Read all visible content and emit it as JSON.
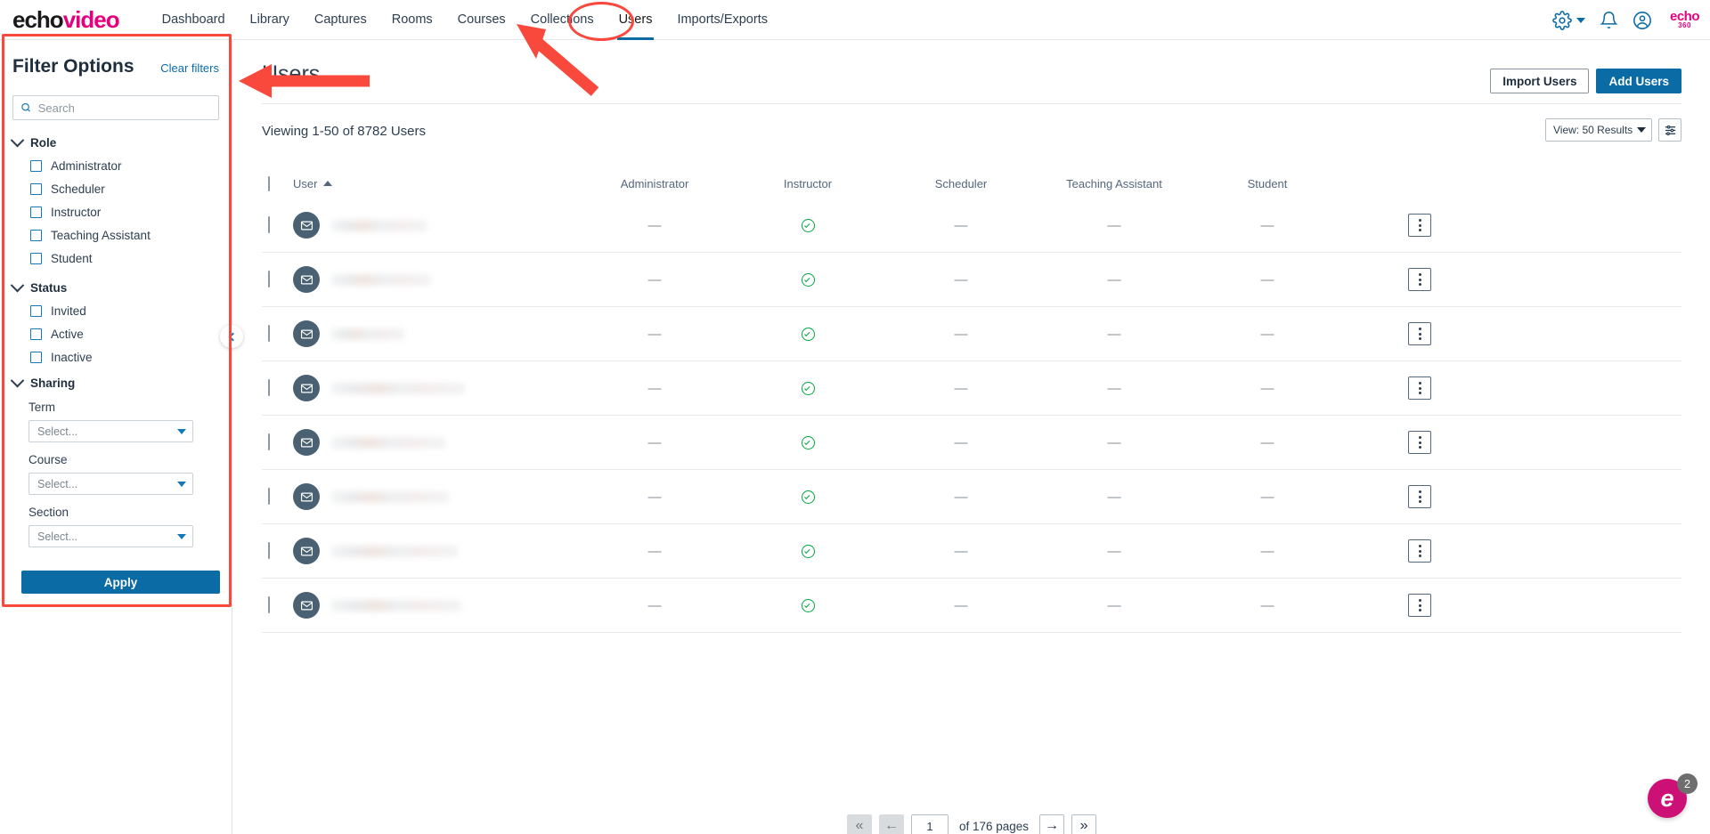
{
  "topnav": {
    "logo_echo": "echo",
    "logo_video": "video",
    "links": [
      {
        "label": "Dashboard",
        "active": false
      },
      {
        "label": "Library",
        "active": false
      },
      {
        "label": "Captures",
        "active": false
      },
      {
        "label": "Rooms",
        "active": false
      },
      {
        "label": "Courses",
        "active": false
      },
      {
        "label": "Collections",
        "active": false
      },
      {
        "label": "Users",
        "active": true
      },
      {
        "label": "Imports/Exports",
        "active": false
      }
    ],
    "icons": {
      "settings": "gear-icon",
      "settings_caret": "chevron-down-icon",
      "notifications": "bell-icon",
      "account": "user-avatar-icon"
    },
    "brand_badge_top": "echo",
    "brand_badge_bottom": "360"
  },
  "sidebar": {
    "title": "Filter Options",
    "clear_label": "Clear filters",
    "search_placeholder": "Search",
    "search_value": "",
    "groups": [
      {
        "label": "Role",
        "options": [
          {
            "label": "Administrator",
            "checked": false
          },
          {
            "label": "Scheduler",
            "checked": false
          },
          {
            "label": "Instructor",
            "checked": false
          },
          {
            "label": "Teaching Assistant",
            "checked": false
          },
          {
            "label": "Student",
            "checked": false
          }
        ]
      },
      {
        "label": "Status",
        "options": [
          {
            "label": "Invited",
            "checked": false
          },
          {
            "label": "Active",
            "checked": false
          },
          {
            "label": "Inactive",
            "checked": false
          }
        ]
      }
    ],
    "sharing": {
      "label": "Sharing",
      "fields": [
        {
          "label": "Term",
          "value": "Select..."
        },
        {
          "label": "Course",
          "value": "Select..."
        },
        {
          "label": "Section",
          "value": "Select..."
        }
      ]
    },
    "apply_label": "Apply"
  },
  "main": {
    "page_title": "Users",
    "import_label": "Import Users",
    "add_label": "Add Users",
    "viewing_text": "Viewing 1-50 of 8782 Users",
    "view_select_label": "View: 50 Results",
    "settings_icon": "sliders-icon"
  },
  "table": {
    "columns": [
      "User",
      "Administrator",
      "Instructor",
      "Scheduler",
      "Teaching Assistant",
      "Student"
    ],
    "sort_column": "User",
    "sort_direction": "asc",
    "rows": [
      {
        "user": "",
        "redacted": true,
        "blur_width": 108,
        "administrator": "—",
        "instructor": "check",
        "scheduler": "—",
        "teaching_assistant": "—",
        "student": "—"
      },
      {
        "user": "",
        "redacted": true,
        "blur_width": 112,
        "administrator": "—",
        "instructor": "check",
        "scheduler": "—",
        "teaching_assistant": "—",
        "student": "—"
      },
      {
        "user": "",
        "redacted": true,
        "blur_width": 82,
        "administrator": "—",
        "instructor": "check",
        "scheduler": "—",
        "teaching_assistant": "—",
        "student": "—"
      },
      {
        "user": "",
        "redacted": true,
        "blur_width": 150,
        "administrator": "—",
        "instructor": "check",
        "scheduler": "—",
        "teaching_assistant": "—",
        "student": "—"
      },
      {
        "user": "",
        "redacted": true,
        "blur_width": 128,
        "administrator": "—",
        "instructor": "check",
        "scheduler": "—",
        "teaching_assistant": "—",
        "student": "—"
      },
      {
        "user": "",
        "redacted": true,
        "blur_width": 132,
        "administrator": "—",
        "instructor": "check",
        "scheduler": "—",
        "teaching_assistant": "—",
        "student": "—"
      },
      {
        "user": "",
        "redacted": true,
        "blur_width": 142,
        "administrator": "—",
        "instructor": "check",
        "scheduler": "—",
        "teaching_assistant": "—",
        "student": "—"
      },
      {
        "user": "",
        "redacted": true,
        "blur_width": 146,
        "administrator": "—",
        "instructor": "check",
        "scheduler": "—",
        "teaching_assistant": "—",
        "student": "—"
      }
    ]
  },
  "pagination": {
    "first_label": "«",
    "prev_label": "←",
    "page_value": "1",
    "of_pages_text": "of 176 pages",
    "next_label": "→",
    "last_label": "»"
  },
  "help_widget": {
    "letter": "e",
    "badge_count": "2"
  },
  "annotations": {
    "colors": {
      "marker": "#f9483c",
      "accent": "#0b6ba5",
      "brand": "#e6007e",
      "success": "#00a63f"
    },
    "shapes": [
      {
        "type": "rectangle",
        "target": "filter-options-panel"
      },
      {
        "type": "ellipse",
        "target": "nav-users-tab"
      },
      {
        "type": "arrow",
        "target": "filter-options-panel",
        "direction": "left"
      },
      {
        "type": "arrow",
        "target": "nav-users-tab",
        "direction": "up-left"
      }
    ]
  }
}
